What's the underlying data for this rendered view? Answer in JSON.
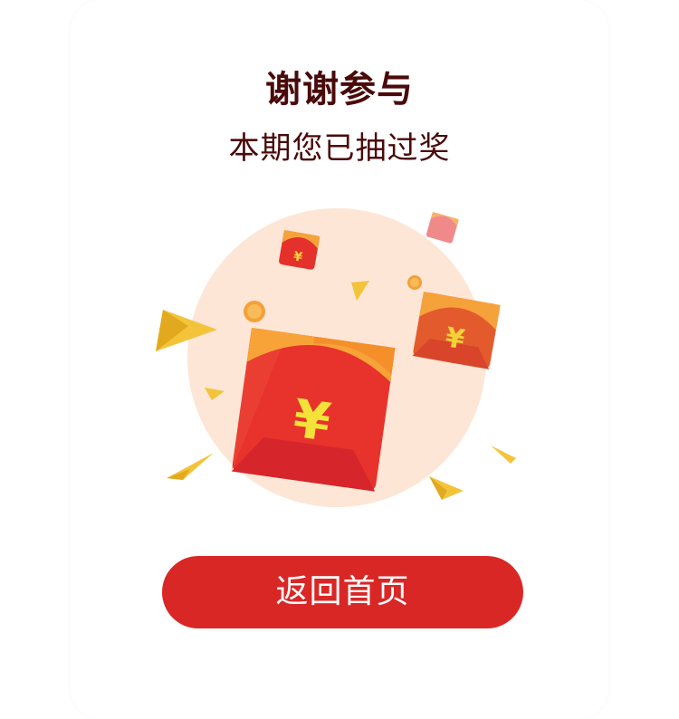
{
  "result": {
    "title": "谢谢参与",
    "subtitle": "本期您已抽过奖"
  },
  "actions": {
    "home_label": "返回首页"
  },
  "illustration": {
    "currency_symbol": "¥",
    "icons": [
      "red-envelope-icon",
      "coin-icon",
      "gold-diamond-icon"
    ]
  },
  "colors": {
    "title": "#4a0a0a",
    "button": "#d92726",
    "button_text": "#ffffff",
    "circle": "#fde6d6",
    "envelope_red": "#e8322c",
    "envelope_flap": "#f6a23a",
    "gold": "#f3c43a"
  }
}
